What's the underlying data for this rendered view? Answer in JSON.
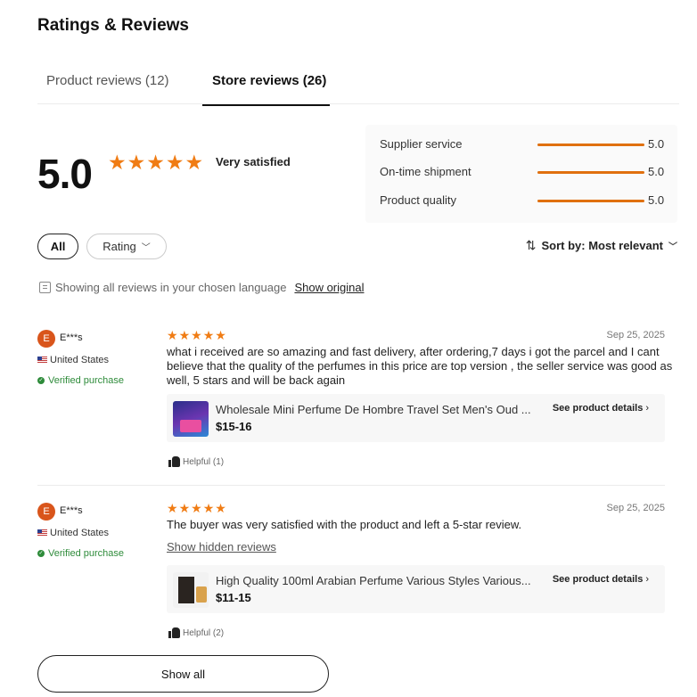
{
  "header": {
    "title": "Ratings & Reviews"
  },
  "tabs": [
    {
      "label": "Product reviews  (12)"
    },
    {
      "label": "Store reviews (26)"
    }
  ],
  "summary": {
    "score": "5.0",
    "star_count": 5,
    "sentiment": "Very satisfied",
    "metrics": [
      {
        "label": "Supplier service",
        "value": "5.0",
        "fraction": 1.0
      },
      {
        "label": "On-time shipment",
        "value": "5.0",
        "fraction": 1.0
      },
      {
        "label": "Product quality",
        "value": "5.0",
        "fraction": 1.0
      }
    ]
  },
  "filters": {
    "all_label": "All",
    "rating_label": "Rating",
    "sort_label": "Sort by: Most relevant"
  },
  "language": {
    "notice": "Showing all reviews in your chosen language",
    "link": "Show original"
  },
  "reviews": [
    {
      "avatar_letter": "E",
      "user": "E***s",
      "country": "United States",
      "verified": "Verified purchase",
      "stars": 5,
      "date": "Sep 25, 2025",
      "text": "what i received are so amazing and fast delivery, after ordering,7 days i got the parcel and I cant believe that the quality of the perfumes in this price are top version , the seller service was good as well, 5 stars and will be back again",
      "product_name": "Wholesale Mini Perfume De Hombre Travel Set Men's Oud ...",
      "product_price": "$15-16",
      "details_label": "See product details",
      "helpful": "Helpful (1)"
    },
    {
      "avatar_letter": "E",
      "user": "E***s",
      "country": "United States",
      "verified": "Verified purchase",
      "stars": 5,
      "date": "Sep 25, 2025",
      "text": "The buyer was very satisfied with the product and left a 5-star review.",
      "hidden_link": "Show hidden reviews",
      "product_name": "High Quality 100ml Arabian Perfume Various Styles Various...",
      "product_price": "$11-15",
      "details_label": "See product details",
      "helpful": "Helpful (2)"
    }
  ],
  "footer": {
    "show_all_label": "Show all"
  },
  "colors": {
    "accent_orange": "#f07c14",
    "verified_green": "#2e8b3a"
  }
}
